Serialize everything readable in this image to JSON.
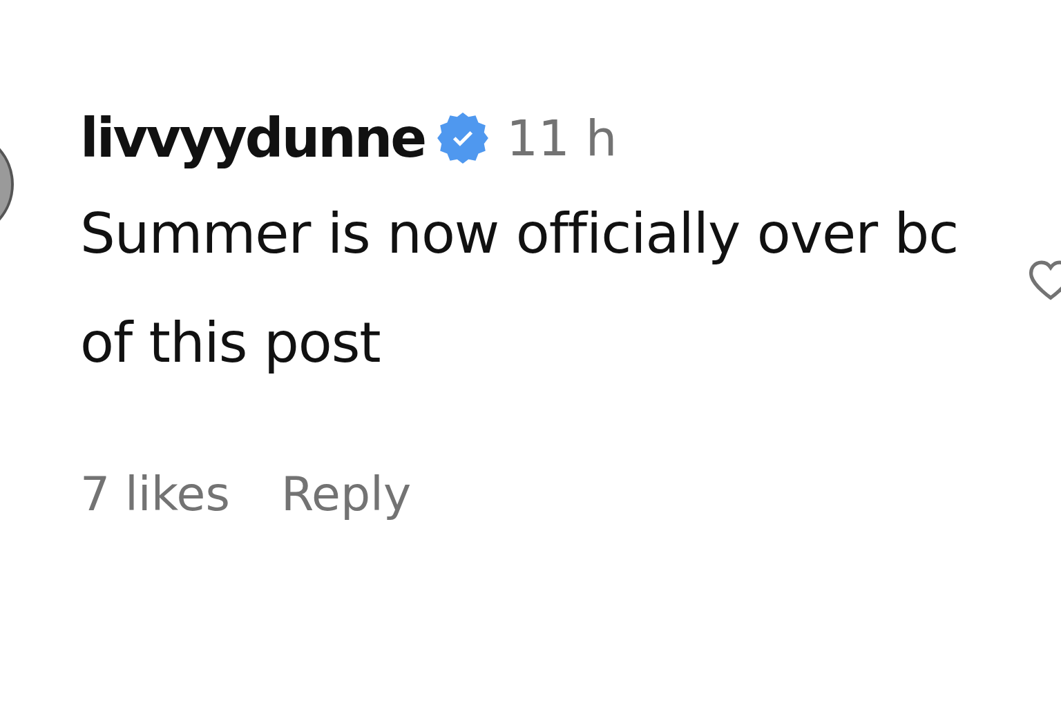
{
  "comment": {
    "username": "livvyydunne",
    "verified": true,
    "time": "11 h",
    "text": "Summer is now officially over bc of this post",
    "likes": "7 likes",
    "reply": "Reply",
    "liked": false
  }
}
